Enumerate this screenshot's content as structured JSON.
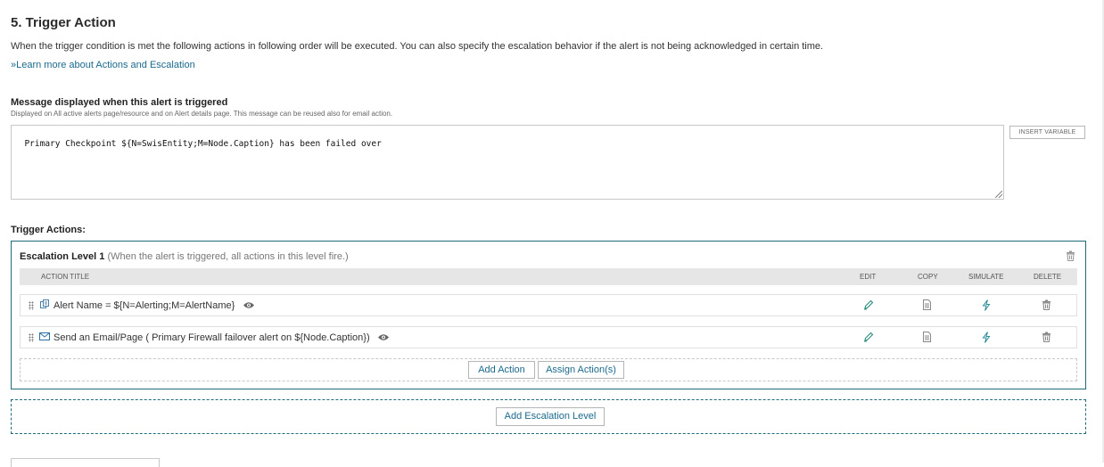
{
  "section": {
    "title": "5. Trigger Action",
    "description": "When the trigger condition is met the following actions in following order will be executed. You can also specify the escalation behavior if the alert is not being acknowledged in certain time.",
    "learn_more": "»Learn more about Actions and Escalation"
  },
  "message": {
    "label": "Message displayed when this alert is triggered",
    "hint": "Displayed on All active alerts page/resource and on Alert details page. This message can be reused also for email action.",
    "value": "Primary Checkpoint ${N=SwisEntity;M=Node.Caption} has been failed over",
    "insert_variable": "INSERT VARIABLE"
  },
  "trigger_actions": {
    "label": "Trigger Actions:",
    "level_title": "Escalation Level 1",
    "level_subtitle": "(When the alert is triggered, all actions in this level fire.)",
    "columns": {
      "title": "ACTION TITLE",
      "edit": "EDIT",
      "copy": "COPY",
      "simulate": "SIMULATE",
      "delete": "DELETE"
    },
    "rows": [
      {
        "title": "Alert Name = ${N=Alerting;M=AlertName}",
        "icon": "custom-property-icon"
      },
      {
        "title": "Send an Email/Page ( Primary Firewall failover alert on ${Node.Caption})",
        "icon": "envelope-icon"
      }
    ],
    "add_action": "Add Action",
    "assign_action": "Assign Action(s)",
    "add_escalation": "Add Escalation Level"
  },
  "colors": {
    "accent": "#1f6b7c",
    "link": "#1a6a8c",
    "header_bg": "#e6e6e6"
  }
}
